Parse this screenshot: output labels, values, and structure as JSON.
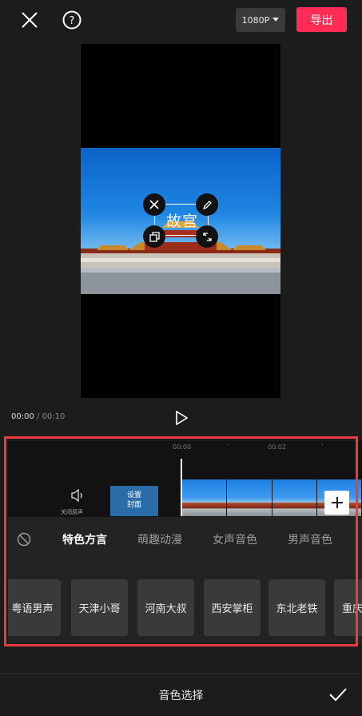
{
  "topbar": {
    "close_icon": "close-icon",
    "help_icon": "help-icon",
    "resolution": "1080P",
    "export": "导出"
  },
  "preview": {
    "text_overlay": "故宫"
  },
  "playback": {
    "current": "00:00",
    "separator": " / ",
    "total": "00:10"
  },
  "timeline": {
    "ruler": [
      "00:00",
      "00:02"
    ],
    "mute_label": "关闭原声",
    "cover_label_1": "设置",
    "cover_label_2": "封面"
  },
  "voice_panel": {
    "tabs": [
      "特色方言",
      "萌趣动漫",
      "女声音色",
      "男声音色"
    ],
    "active_tab": 0,
    "voices": [
      "粤语男声",
      "天津小哥",
      "河南大叔",
      "西安掌柜",
      "东北老铁",
      "重庆"
    ]
  },
  "bottom": {
    "title": "音色选择"
  },
  "colors": {
    "export": "#ff2d55",
    "highlight": "#f0383f"
  }
}
